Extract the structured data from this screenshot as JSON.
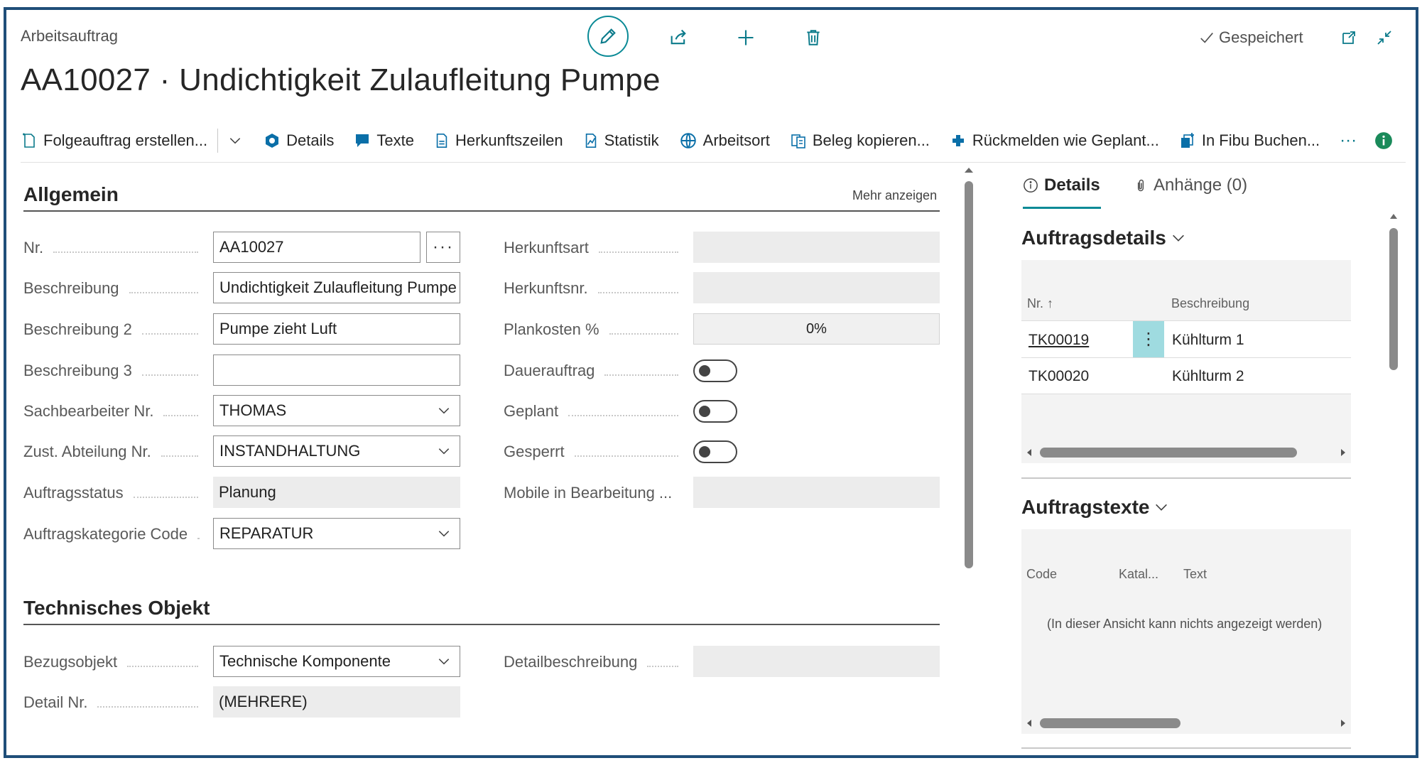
{
  "header": {
    "caption": "Arbeitsauftrag",
    "title": "AA10027 · Undichtigkeit Zulaufleitung Pumpe",
    "saved_status": "Gespeichert"
  },
  "toolbar": {
    "items": [
      {
        "label": "Folgeauftrag erstellen...",
        "icon": "new-document-icon"
      },
      {
        "label": "Details",
        "icon": "details-icon"
      },
      {
        "label": "Texte",
        "icon": "comment-icon"
      },
      {
        "label": "Herkunftszeilen",
        "icon": "document-icon"
      },
      {
        "label": "Statistik",
        "icon": "statistics-icon"
      },
      {
        "label": "Arbeitsort",
        "icon": "globe-icon"
      },
      {
        "label": "Beleg kopieren...",
        "icon": "copy-document-icon"
      },
      {
        "label": "Rückmelden wie Geplant...",
        "icon": "post-icon"
      },
      {
        "label": "In Fibu Buchen...",
        "icon": "post-batch-icon"
      }
    ],
    "more": "···"
  },
  "general": {
    "title": "Allgemein",
    "more_link": "Mehr anzeigen",
    "left_fields": [
      {
        "label": "Nr.",
        "value": "AA10027"
      },
      {
        "label": "Beschreibung",
        "value": "Undichtigkeit Zulaufleitung Pumpe"
      },
      {
        "label": "Beschreibung 2",
        "value": "Pumpe zieht Luft"
      },
      {
        "label": "Beschreibung 3",
        "value": ""
      },
      {
        "label": "Sachbearbeiter Nr.",
        "value": "THOMAS"
      },
      {
        "label": "Zust. Abteilung Nr.",
        "value": "INSTANDHALTUNG"
      },
      {
        "label": "Auftragsstatus",
        "value": "Planung"
      },
      {
        "label": "Auftragskategorie Code",
        "value": "REPARATUR"
      }
    ],
    "right_fields": [
      {
        "label": "Herkunftsart",
        "value": ""
      },
      {
        "label": "Herkunftsnr.",
        "value": ""
      },
      {
        "label": "Plankosten %",
        "value": "0%"
      },
      {
        "label": "Dauerauftrag",
        "value": "off"
      },
      {
        "label": "Geplant",
        "value": "off"
      },
      {
        "label": "Gesperrt",
        "value": "off"
      },
      {
        "label": "Mobile in Bearbeitung ...",
        "value": ""
      }
    ],
    "assist_label": "···"
  },
  "technical": {
    "title": "Technisches Objekt",
    "left_fields": [
      {
        "label": "Bezugsobjekt",
        "value": "Technische Komponente"
      },
      {
        "label": "Detail Nr.",
        "value": "(MEHRERE)"
      }
    ],
    "right_fields": [
      {
        "label": "Detailbeschreibung",
        "value": ""
      }
    ]
  },
  "factbox": {
    "tabs": [
      {
        "label": "Details",
        "icon": "info-icon"
      },
      {
        "label": "Anhänge (0)",
        "icon": "paperclip-icon"
      }
    ],
    "order_details": {
      "title": "Auftragsdetails",
      "columns": [
        "Nr. ↑",
        "Beschreibung"
      ],
      "rows": [
        {
          "nr": "TK00019",
          "desc": "Kühlturm 1",
          "menu": "⋮"
        },
        {
          "nr": "TK00020",
          "desc": "Kühlturm 2"
        }
      ]
    },
    "order_texts": {
      "title": "Auftragstexte",
      "columns": [
        "Code",
        "Katal...",
        "Text"
      ],
      "empty": "(In dieser Ansicht kann nichts angezeigt werden)"
    }
  },
  "colors": {
    "accent": "#0a8a96",
    "frame": "#1f4e79",
    "info": "#1a8a5a"
  }
}
